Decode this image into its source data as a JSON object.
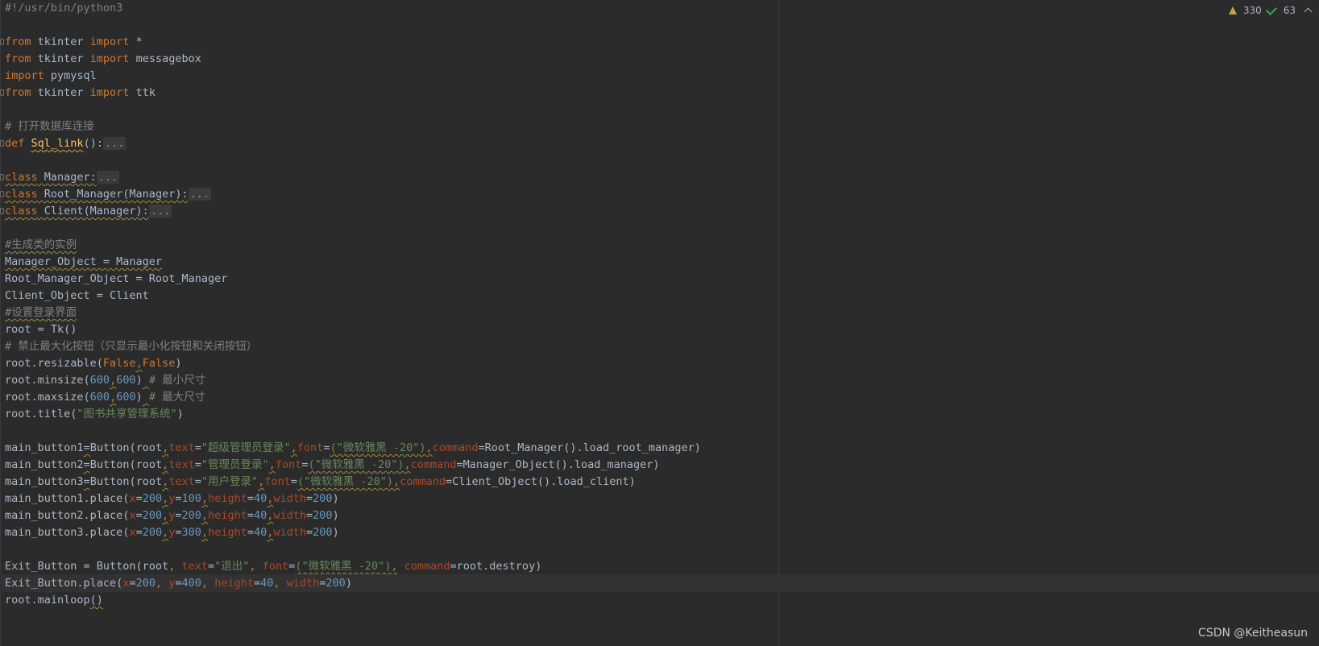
{
  "inspection": {
    "warnings_count": "330",
    "weak_warnings_count": "63"
  },
  "watermark": "CSDN @Keitheasun",
  "code_lines": [
    [
      {
        "t": "#!/usr/bin/python3",
        "c": "t-shebang"
      }
    ],
    [],
    [
      {
        "t": "from",
        "c": "t-kw"
      },
      {
        "t": " tkinter ",
        "c": "t-id"
      },
      {
        "t": "import",
        "c": "t-kw"
      },
      {
        "t": " *",
        "c": "t-id"
      }
    ],
    [
      {
        "t": "from",
        "c": "t-kw"
      },
      {
        "t": " tkinter ",
        "c": "t-id"
      },
      {
        "t": "import",
        "c": "t-kw"
      },
      {
        "t": " messagebox",
        "c": "t-id"
      }
    ],
    [
      {
        "t": "import",
        "c": "t-kw"
      },
      {
        "t": " pymysql",
        "c": "t-id"
      }
    ],
    [
      {
        "t": "from",
        "c": "t-kw"
      },
      {
        "t": " tkinter ",
        "c": "t-id"
      },
      {
        "t": "import",
        "c": "t-kw"
      },
      {
        "t": " ttk",
        "c": "t-id"
      }
    ],
    [],
    [
      {
        "t": "# 打开数据库连接",
        "c": "t-cm"
      }
    ],
    [
      {
        "t": "def",
        "c": "t-def"
      },
      {
        "t": " ",
        "c": "t-id"
      },
      {
        "t": "Sql_link",
        "c": "t-fn"
      },
      {
        "t": "():",
        "c": "t-id"
      },
      {
        "t": "...",
        "c": "t-folded"
      }
    ],
    [],
    [
      {
        "t": "class",
        "c": "t-kw wavy"
      },
      {
        "t": " Manager:",
        "c": "t-id wavy"
      },
      {
        "t": "...",
        "c": "t-folded"
      }
    ],
    [
      {
        "t": "class",
        "c": "t-kw wavy"
      },
      {
        "t": " Root_Manager(Manager):",
        "c": "t-id wavy"
      },
      {
        "t": "...",
        "c": "t-folded"
      }
    ],
    [
      {
        "t": "class",
        "c": "t-kw wavy"
      },
      {
        "t": " Client(Manager):",
        "c": "t-id wavy"
      },
      {
        "t": "...",
        "c": "t-folded"
      }
    ],
    [],
    [
      {
        "t": "#生成类的实例",
        "c": "t-cm wavy"
      }
    ],
    [
      {
        "t": "Manager_Object = Manager",
        "c": "t-id wavy"
      }
    ],
    [
      {
        "t": "Root_Manager_Object = Root_Manager",
        "c": "t-id"
      }
    ],
    [
      {
        "t": "Client_Object = Client",
        "c": "t-id"
      }
    ],
    [
      {
        "t": "#设置登录界面",
        "c": "t-cm wavy"
      }
    ],
    [
      {
        "t": "root = Tk()",
        "c": "t-id"
      }
    ],
    [
      {
        "t": "# 禁止最大化按钮（只显示最小化按钮和关闭按钮）",
        "c": "t-cm"
      }
    ],
    [
      {
        "t": "root.resizable(",
        "c": "t-id"
      },
      {
        "t": "False",
        "c": "t-bool"
      },
      {
        "t": ",",
        "c": "t-kw wavy"
      },
      {
        "t": "False",
        "c": "t-bool"
      },
      {
        "t": ")",
        "c": "t-id"
      }
    ],
    [
      {
        "t": "root.minsize(",
        "c": "t-id"
      },
      {
        "t": "600",
        "c": "t-num"
      },
      {
        "t": ",",
        "c": "t-kw wavy"
      },
      {
        "t": "600",
        "c": "t-num"
      },
      {
        "t": ")",
        "c": "t-id"
      },
      {
        "t": " ",
        "c": "t-id wavy"
      },
      {
        "t": "# 最小尺寸",
        "c": "t-cm"
      }
    ],
    [
      {
        "t": "root.maxsize(",
        "c": "t-id"
      },
      {
        "t": "600",
        "c": "t-num"
      },
      {
        "t": ",",
        "c": "t-kw wavy"
      },
      {
        "t": "600",
        "c": "t-num"
      },
      {
        "t": ")",
        "c": "t-id"
      },
      {
        "t": " ",
        "c": "t-id wavy"
      },
      {
        "t": "# 最大尺寸",
        "c": "t-cm"
      }
    ],
    [
      {
        "t": "root.title(",
        "c": "t-id"
      },
      {
        "t": "\"图书共享管理系统\"",
        "c": "t-str"
      },
      {
        "t": ")",
        "c": "t-id"
      }
    ],
    [],
    [
      {
        "t": "main_button1",
        "c": "t-id"
      },
      {
        "t": "=",
        "c": "t-id wavy"
      },
      {
        "t": "Button(root",
        "c": "t-id"
      },
      {
        "t": ",",
        "c": "t-kw wavy"
      },
      {
        "t": "text",
        "c": "t-param"
      },
      {
        "t": "=",
        "c": "t-id"
      },
      {
        "t": "\"超级管理员登录\"",
        "c": "t-str"
      },
      {
        "t": ",",
        "c": "t-kw wavy"
      },
      {
        "t": "font",
        "c": "t-param"
      },
      {
        "t": "=",
        "c": "t-id"
      },
      {
        "t": "(\"微软雅黑 -20\")",
        "c": "t-str wavy"
      },
      {
        "t": ",",
        "c": "t-kw wavy"
      },
      {
        "t": "command",
        "c": "t-param"
      },
      {
        "t": "=Root_Manager().load_root_manager)",
        "c": "t-id"
      }
    ],
    [
      {
        "t": "main_button2",
        "c": "t-id"
      },
      {
        "t": "=",
        "c": "t-id wavy"
      },
      {
        "t": "Button(root",
        "c": "t-id"
      },
      {
        "t": ",",
        "c": "t-kw wavy"
      },
      {
        "t": "text",
        "c": "t-param"
      },
      {
        "t": "=",
        "c": "t-id"
      },
      {
        "t": "\"管理员登录\"",
        "c": "t-str"
      },
      {
        "t": ",",
        "c": "t-kw wavy"
      },
      {
        "t": "font",
        "c": "t-param"
      },
      {
        "t": "=",
        "c": "t-id"
      },
      {
        "t": "(\"微软雅黑 -20\")",
        "c": "t-str wavy"
      },
      {
        "t": ",",
        "c": "t-kw wavy"
      },
      {
        "t": "command",
        "c": "t-param"
      },
      {
        "t": "=Manager_Object().load_manager)",
        "c": "t-id"
      }
    ],
    [
      {
        "t": "main_button3",
        "c": "t-id"
      },
      {
        "t": "=",
        "c": "t-id wavy"
      },
      {
        "t": "Button(root",
        "c": "t-id"
      },
      {
        "t": ",",
        "c": "t-kw wavy"
      },
      {
        "t": "text",
        "c": "t-param"
      },
      {
        "t": "=",
        "c": "t-id"
      },
      {
        "t": "\"用户登录\"",
        "c": "t-str"
      },
      {
        "t": ",",
        "c": "t-kw wavy"
      },
      {
        "t": "font",
        "c": "t-param"
      },
      {
        "t": "=",
        "c": "t-id"
      },
      {
        "t": "(\"微软雅黑 -20\")",
        "c": "t-str wavy"
      },
      {
        "t": ",",
        "c": "t-kw wavy"
      },
      {
        "t": "command",
        "c": "t-param"
      },
      {
        "t": "=Client_Object().load_client)",
        "c": "t-id"
      }
    ],
    [
      {
        "t": "main_button1.place(",
        "c": "t-id"
      },
      {
        "t": "x",
        "c": "t-param"
      },
      {
        "t": "=",
        "c": "t-id"
      },
      {
        "t": "200",
        "c": "t-num"
      },
      {
        "t": ",",
        "c": "t-kw wavy"
      },
      {
        "t": "y",
        "c": "t-param"
      },
      {
        "t": "=",
        "c": "t-id"
      },
      {
        "t": "100",
        "c": "t-num"
      },
      {
        "t": ",",
        "c": "t-kw wavy"
      },
      {
        "t": "height",
        "c": "t-param"
      },
      {
        "t": "=",
        "c": "t-id"
      },
      {
        "t": "40",
        "c": "t-num"
      },
      {
        "t": ",",
        "c": "t-kw wavy"
      },
      {
        "t": "width",
        "c": "t-param"
      },
      {
        "t": "=",
        "c": "t-id"
      },
      {
        "t": "200",
        "c": "t-num"
      },
      {
        "t": ")",
        "c": "t-id"
      }
    ],
    [
      {
        "t": "main_button2.place(",
        "c": "t-id"
      },
      {
        "t": "x",
        "c": "t-param"
      },
      {
        "t": "=",
        "c": "t-id"
      },
      {
        "t": "200",
        "c": "t-num"
      },
      {
        "t": ",",
        "c": "t-kw wavy"
      },
      {
        "t": "y",
        "c": "t-param"
      },
      {
        "t": "=",
        "c": "t-id"
      },
      {
        "t": "200",
        "c": "t-num"
      },
      {
        "t": ",",
        "c": "t-kw wavy"
      },
      {
        "t": "height",
        "c": "t-param"
      },
      {
        "t": "=",
        "c": "t-id"
      },
      {
        "t": "40",
        "c": "t-num"
      },
      {
        "t": ",",
        "c": "t-kw wavy"
      },
      {
        "t": "width",
        "c": "t-param"
      },
      {
        "t": "=",
        "c": "t-id"
      },
      {
        "t": "200",
        "c": "t-num"
      },
      {
        "t": ")",
        "c": "t-id"
      }
    ],
    [
      {
        "t": "main_button3.place(",
        "c": "t-id"
      },
      {
        "t": "x",
        "c": "t-param"
      },
      {
        "t": "=",
        "c": "t-id"
      },
      {
        "t": "200",
        "c": "t-num"
      },
      {
        "t": ",",
        "c": "t-kw wavy"
      },
      {
        "t": "y",
        "c": "t-param"
      },
      {
        "t": "=",
        "c": "t-id"
      },
      {
        "t": "300",
        "c": "t-num"
      },
      {
        "t": ",",
        "c": "t-kw wavy"
      },
      {
        "t": "height",
        "c": "t-param"
      },
      {
        "t": "=",
        "c": "t-id"
      },
      {
        "t": "40",
        "c": "t-num"
      },
      {
        "t": ",",
        "c": "t-kw wavy"
      },
      {
        "t": "width",
        "c": "t-param"
      },
      {
        "t": "=",
        "c": "t-id"
      },
      {
        "t": "200",
        "c": "t-num"
      },
      {
        "t": ")",
        "c": "t-id"
      }
    ],
    [],
    [
      {
        "t": "Exit_Button = Button(root",
        "c": "t-id"
      },
      {
        "t": ", ",
        "c": "t-kw"
      },
      {
        "t": "text",
        "c": "t-param"
      },
      {
        "t": "=",
        "c": "t-id"
      },
      {
        "t": "\"退出\"",
        "c": "t-str"
      },
      {
        "t": ", ",
        "c": "t-kw"
      },
      {
        "t": "font",
        "c": "t-param"
      },
      {
        "t": "=",
        "c": "t-id"
      },
      {
        "t": "(\"微软雅黑 -20\")",
        "c": "t-str wavy"
      },
      {
        "t": ",",
        "c": "t-kw wavy"
      },
      {
        "t": " ",
        "c": "t-kw"
      },
      {
        "t": "command",
        "c": "t-param"
      },
      {
        "t": "=root.destroy)",
        "c": "t-id"
      }
    ],
    [
      {
        "t": "Exit_Button.place(",
        "c": "t-id"
      },
      {
        "t": "x",
        "c": "t-param"
      },
      {
        "t": "=",
        "c": "t-id"
      },
      {
        "t": "200",
        "c": "t-num"
      },
      {
        "t": ", ",
        "c": "t-kw"
      },
      {
        "t": "y",
        "c": "t-param"
      },
      {
        "t": "=",
        "c": "t-id"
      },
      {
        "t": "400",
        "c": "t-num"
      },
      {
        "t": ", ",
        "c": "t-kw"
      },
      {
        "t": "height",
        "c": "t-param"
      },
      {
        "t": "=",
        "c": "t-id"
      },
      {
        "t": "40",
        "c": "t-num"
      },
      {
        "t": ", ",
        "c": "t-kw"
      },
      {
        "t": "width",
        "c": "t-param"
      },
      {
        "t": "=",
        "c": "t-id"
      },
      {
        "t": "200",
        "c": "t-num"
      },
      {
        "t": ")",
        "c": "t-id"
      }
    ],
    [
      {
        "t": "root.mainloop",
        "c": "t-id"
      },
      {
        "t": "()",
        "c": "t-id wavy"
      }
    ]
  ],
  "current_line_index": 34,
  "fold_lines": [
    2,
    5,
    8,
    10,
    11,
    12
  ]
}
